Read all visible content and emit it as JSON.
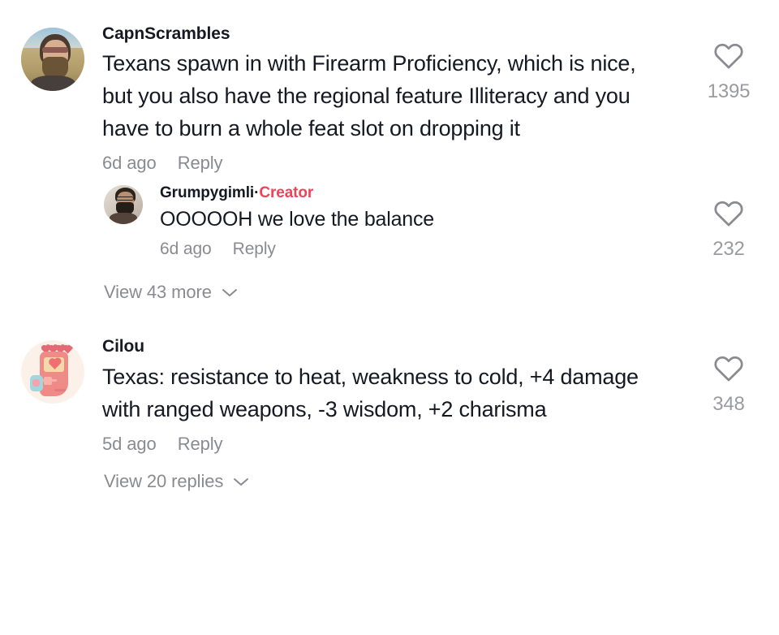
{
  "app": "tiktok-comments",
  "theme": {
    "background": "#ffffff",
    "text_primary": "#161823",
    "text_secondary": "#8a8b91",
    "creator_accent": "#f04259",
    "like_count_color": "#9a9ba1"
  },
  "comments": [
    {
      "id": "c1",
      "username": "CapnScrambles",
      "avatar": "photo-bearded-man-sunglasses-prairie",
      "text": "Texans spawn in with Firearm Proficiency, which is nice, but you also have the regional feature Illiteracy and you have to burn a whole feat slot on dropping it",
      "timestamp": "6d ago",
      "reply_label": "Reply",
      "like_icon": "heart-outline-icon",
      "like_count": "1395",
      "replies": [
        {
          "id": "c1r1",
          "username": "Grumpygimli",
          "separator": "·",
          "badge": "Creator",
          "avatar": "photo-man-glasses-beard-indoor",
          "text": "OOOOOH we love the balance",
          "timestamp": "6d ago",
          "reply_label": "Reply",
          "like_icon": "heart-outline-icon",
          "like_count": "232"
        }
      ],
      "view_more_label": "View 43 more",
      "view_more_icon": "chevron-down-icon"
    },
    {
      "id": "c2",
      "username": "Cilou",
      "avatar": "illustration-pink-handheld-console-hearts",
      "text": "Texas: resistance to heat, weakness to cold, +4 damage with ranged weapons, -3 wisdom, +2 charisma",
      "timestamp": "5d ago",
      "reply_label": "Reply",
      "like_icon": "heart-outline-icon",
      "like_count": "348",
      "replies": [],
      "view_more_label": "View 20 replies",
      "view_more_icon": "chevron-down-icon"
    }
  ]
}
